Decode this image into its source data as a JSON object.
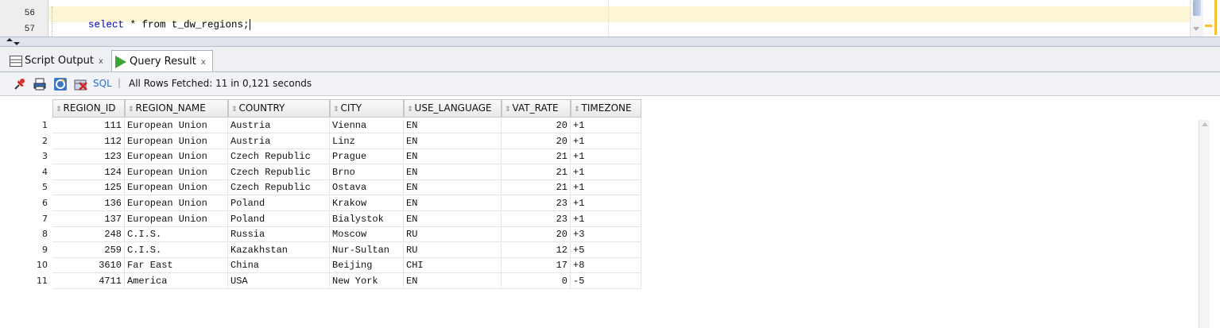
{
  "editor": {
    "lines": [
      {
        "number": "56",
        "keyword": "select",
        "rest": " * from t_dw_regions;"
      },
      {
        "number": "57"
      }
    ]
  },
  "tabs": [
    {
      "label": "Script Output",
      "close": "x",
      "icon": "script-output-icon"
    },
    {
      "label": "Query Result",
      "close": "x",
      "icon": "run-play-icon",
      "active": true
    }
  ],
  "toolbar": {
    "sql_label": "SQL",
    "separator": "|",
    "status": "All Rows Fetched: 11 in 0,121 seconds",
    "icons": [
      "pin-icon",
      "print-icon",
      "refresh-icon",
      "delete-icon"
    ]
  },
  "grid": {
    "columns": [
      "REGION_ID",
      "REGION_NAME",
      "COUNTRY",
      "CITY",
      "USE_LANGUAGE",
      "VAT_RATE",
      "TIMEZONE"
    ],
    "rows": [
      {
        "rn": "1",
        "cells": [
          "111",
          "European Union",
          "Austria",
          "Vienna",
          "EN",
          "20",
          "+1"
        ]
      },
      {
        "rn": "2",
        "cells": [
          "112",
          "European Union",
          "Austria",
          "Linz",
          "EN",
          "20",
          "+1"
        ]
      },
      {
        "rn": "3",
        "cells": [
          "123",
          "European Union",
          "Czech Republic",
          "Prague",
          "EN",
          "21",
          "+1"
        ]
      },
      {
        "rn": "4",
        "cells": [
          "124",
          "European Union",
          "Czech Republic",
          "Brno",
          "EN",
          "21",
          "+1"
        ]
      },
      {
        "rn": "5",
        "cells": [
          "125",
          "European Union",
          "Czech Republic",
          "Ostava",
          "EN",
          "21",
          "+1"
        ]
      },
      {
        "rn": "6",
        "cells": [
          "136",
          "European Union",
          "Poland",
          "Krakow",
          "EN",
          "23",
          "+1"
        ]
      },
      {
        "rn": "7",
        "cells": [
          "137",
          "European Union",
          "Poland",
          "Bialystok",
          "EN",
          "23",
          "+1"
        ]
      },
      {
        "rn": "8",
        "cells": [
          "248",
          "C.I.S.",
          "Russia",
          "Moscow",
          "RU",
          "20",
          "+3"
        ]
      },
      {
        "rn": "9",
        "cells": [
          "259",
          "C.I.S.",
          "Kazakhstan",
          "Nur-Sultan",
          "RU",
          "12",
          "+5"
        ]
      },
      {
        "rn": "10",
        "cells": [
          "3610",
          "Far East",
          "China",
          "Beijing",
          "CHI",
          "17",
          "+8"
        ]
      },
      {
        "rn": "11",
        "cells": [
          "4711",
          "America",
          "USA",
          "New York",
          "EN",
          "0",
          "-5"
        ]
      }
    ]
  },
  "colors": {
    "keyword": "#0000c8",
    "tab_bg": "#eef0f3",
    "header_bg": "#e9e9e9"
  }
}
